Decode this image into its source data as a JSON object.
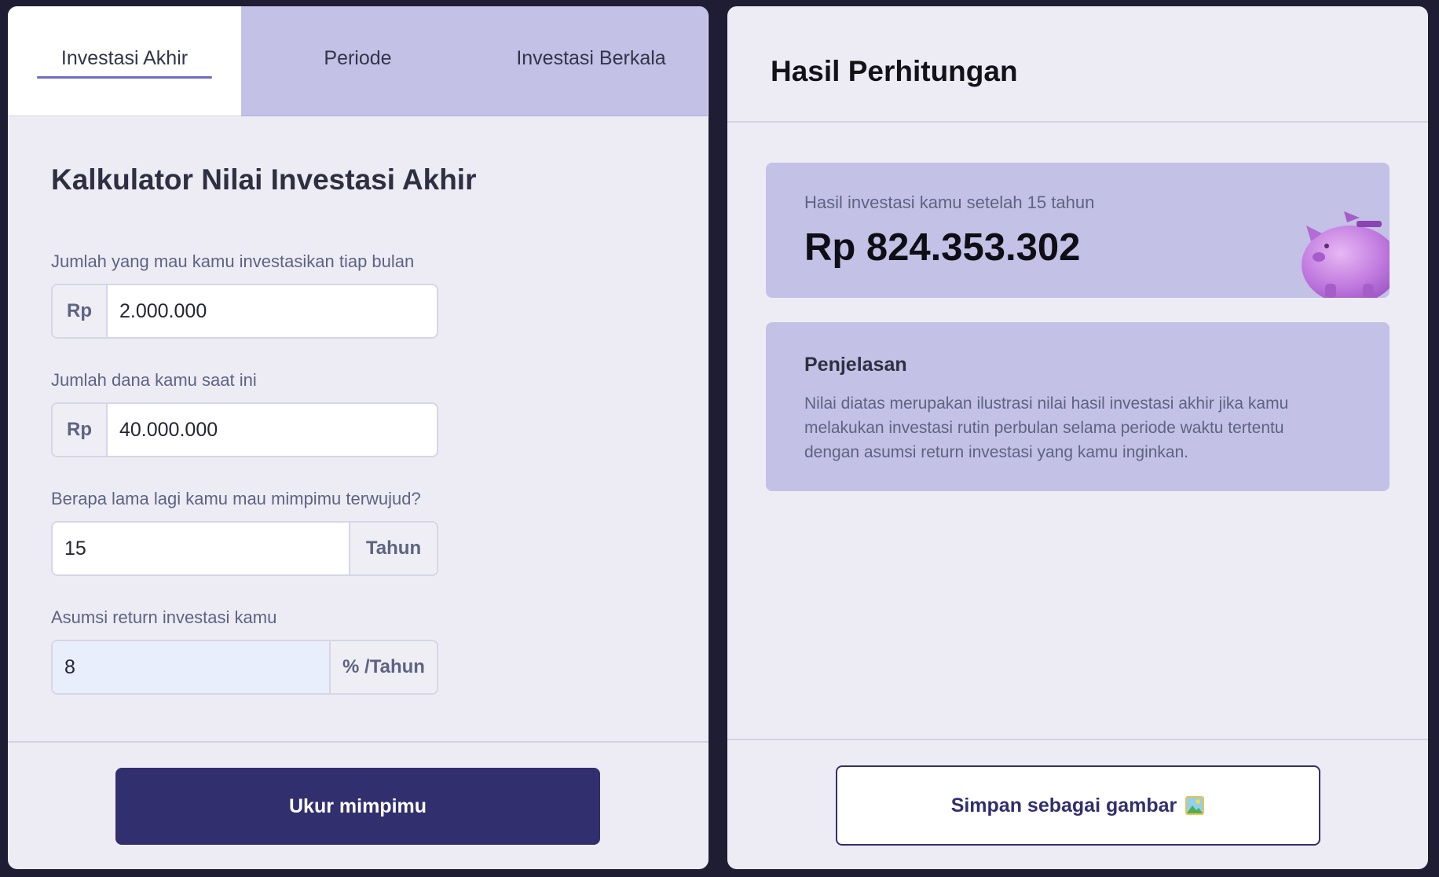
{
  "tabs": [
    {
      "label": "Investasi Akhir",
      "active": true
    },
    {
      "label": "Periode",
      "active": false
    },
    {
      "label": "Investasi Berkala",
      "active": false
    }
  ],
  "form": {
    "title": "Kalkulator Nilai Investasi Akhir",
    "monthly": {
      "label": "Jumlah yang mau kamu investasikan tiap bulan",
      "prefix": "Rp",
      "value": "2.000.000"
    },
    "current": {
      "label": "Jumlah dana kamu saat ini",
      "prefix": "Rp",
      "value": "40.000.000"
    },
    "duration": {
      "label": "Berapa lama lagi kamu mau mimpimu terwujud?",
      "suffix": "Tahun",
      "value": "15"
    },
    "return_rate": {
      "label": "Asumsi return investasi kamu",
      "suffix": "% /Tahun",
      "value": "8"
    },
    "submit_label": "Ukur mimpimu"
  },
  "result": {
    "title": "Hasil Perhitungan",
    "caption": "Hasil investasi kamu setelah 15 tahun",
    "value": "Rp 824.353.302",
    "icon": "piggy-bank-icon",
    "explanation_title": "Penjelasan",
    "explanation_text": "Nilai diatas merupakan ilustrasi nilai hasil investasi akhir jika kamu melakukan investasi rutin perbulan selama periode waktu tertentu dengan asumsi return investasi yang kamu inginkan.",
    "save_label": "Simpan sebagai gambar"
  },
  "colors": {
    "accent": "#322f6e",
    "tab_inactive": "#c3c1e6",
    "panel_bg": "#edecf5",
    "page_bg": "#1f1d33"
  }
}
